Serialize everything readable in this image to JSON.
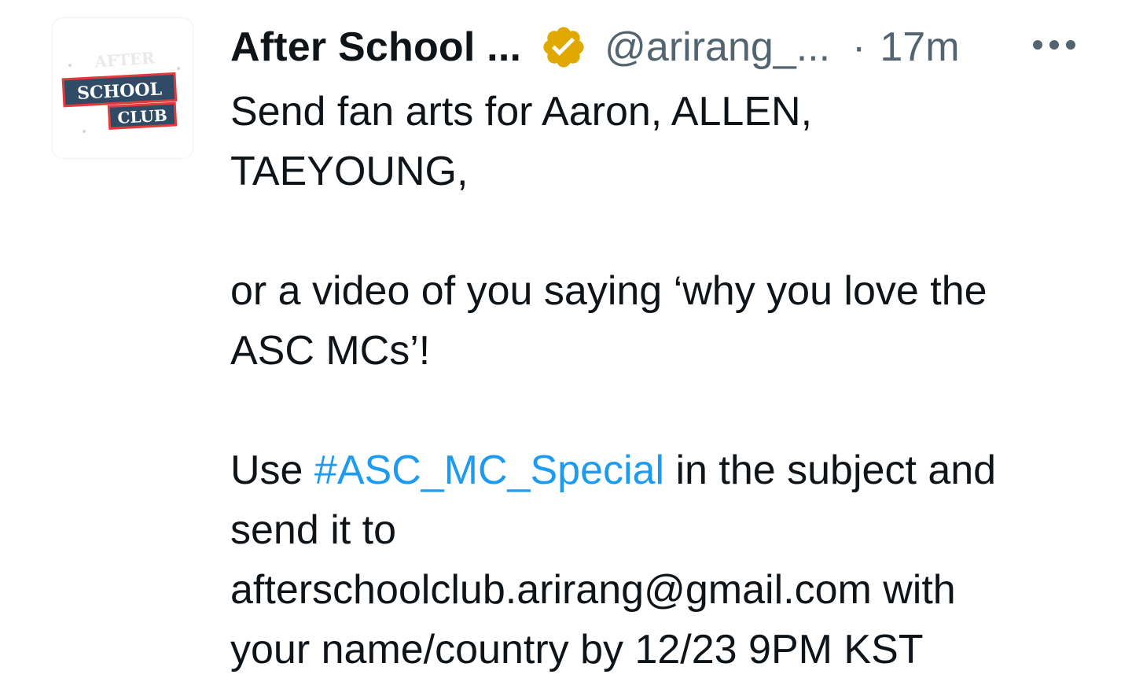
{
  "tweet": {
    "display_name": "After School ...",
    "handle": "@arirang_...",
    "separator": "·",
    "time": "17m",
    "verified_color": "#e0a800",
    "avatar_logo_text": [
      "AFTER",
      "SCHOOL",
      "CLUB"
    ],
    "more_icon": "more-horizontal-icon",
    "text": {
      "line1": "Send fan arts for Aaron, ALLEN,",
      "line2": "TAEYOUNG,",
      "line3": "or a video of you saying ‘why you love the",
      "line4": "ASC MCs’!",
      "line5_pre": "Use ",
      "hashtag": "#ASC_MC_Special",
      "line5_post": " in the subject and",
      "line6": "send it to",
      "line7": "afterschoolclub.arirang@gmail.com with",
      "line8": "your name/country by 12/23 9PM KST"
    },
    "colors": {
      "text": "#0f1419",
      "secondary": "#536471",
      "link": "#1d9bf0"
    }
  }
}
